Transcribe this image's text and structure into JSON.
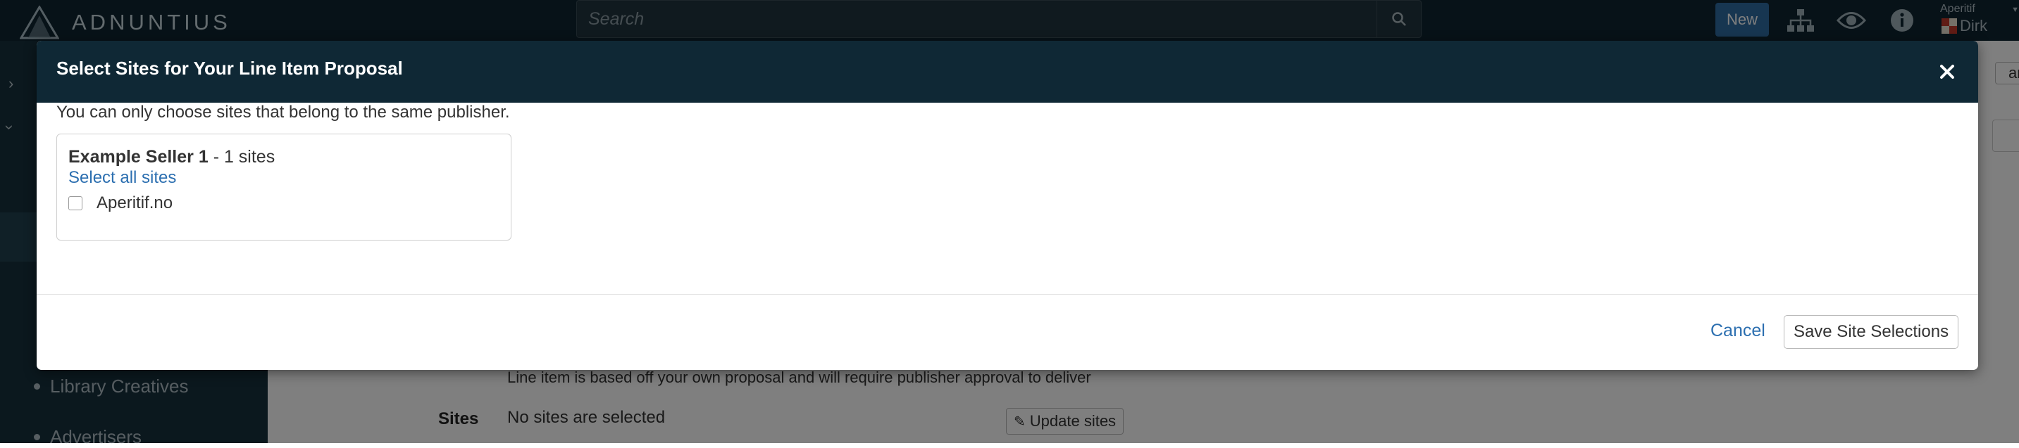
{
  "topbar": {
    "brand": "ADNUNTIUS",
    "search_placeholder": "Search",
    "new_label": "New",
    "user_org": "Aperitif",
    "user_name": "Dirk"
  },
  "sidebar": {
    "items": [
      {
        "label": "Library Creatives"
      },
      {
        "label": "Advertisers"
      }
    ]
  },
  "main": {
    "clear_label": "ar",
    "approval_note": "Line item is based off your own proposal and will require publisher approval to deliver",
    "sites_label": "Sites",
    "sites_value": "No sites are selected",
    "update_sites_label": "Update sites"
  },
  "modal": {
    "title": "Select Sites for Your Line Item Proposal",
    "note": "You can only choose sites that belong to the same publisher.",
    "publisher": {
      "name": "Example Seller 1",
      "count_text": "- 1 sites",
      "select_all_label": "Select all sites",
      "sites": [
        {
          "label": "Aperitif.no",
          "checked": false
        }
      ]
    },
    "cancel_label": "Cancel",
    "save_label": "Save Site Selections"
  },
  "colors": {
    "topbar_bg": "#0f2430",
    "modal_header_bg": "#0f2835",
    "link": "#2c6fb0",
    "new_button": "#2f6da3",
    "backdrop": "rgba(0,0,0,0.5)"
  }
}
